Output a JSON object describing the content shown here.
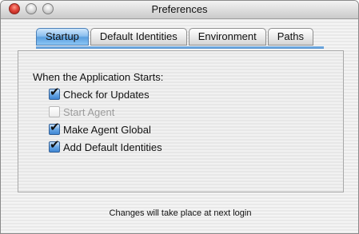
{
  "window": {
    "title": "Preferences"
  },
  "tabs": [
    {
      "label": "Startup",
      "active": true
    },
    {
      "label": "Default Identities",
      "active": false
    },
    {
      "label": "Environment",
      "active": false
    },
    {
      "label": "Paths",
      "active": false
    }
  ],
  "startup": {
    "heading": "When the Application Starts:",
    "options": [
      {
        "label": "Check for Updates",
        "checked": true,
        "enabled": true
      },
      {
        "label": "Start Agent",
        "checked": false,
        "enabled": false
      },
      {
        "label": "Make Agent Global",
        "checked": true,
        "enabled": true
      },
      {
        "label": "Add Default Identities",
        "checked": true,
        "enabled": true
      }
    ]
  },
  "footer": {
    "note": "Changes will take place at next login"
  },
  "icons": {
    "check": "✔"
  },
  "colors": {
    "accent": "#5a9fdf",
    "close": "#e0443a"
  }
}
